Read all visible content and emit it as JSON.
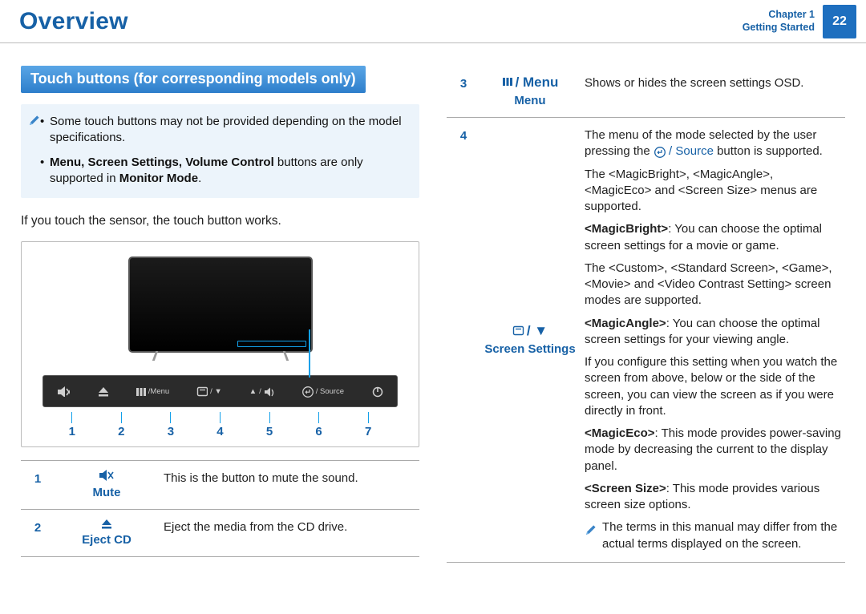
{
  "header": {
    "title": "Overview",
    "chapter_label": "Chapter 1",
    "section_label": "Getting Started",
    "page_no": "22"
  },
  "section_title": "Touch buttons (for corresponding models only)",
  "note_items": [
    {
      "prefix": "• ",
      "html": "Some touch buttons may not be provided depending on the model specifications."
    },
    {
      "prefix": "• ",
      "bold_lead": "Menu, Screen Settings, Volume Control",
      "mid": " buttons are only supported in ",
      "bold_tail": "Monitor Mode",
      "end": "."
    }
  ],
  "intro_line": "If you touch the sensor, the touch button works.",
  "btn_bar": {
    "cells": [
      {
        "name": "mute-btn"
      },
      {
        "name": "eject-btn"
      },
      {
        "name": "menu-btn",
        "text": "/Menu"
      },
      {
        "name": "screenset-btn",
        "text": "/ ▼"
      },
      {
        "name": "volume-btn",
        "text": "/"
      },
      {
        "name": "source-btn",
        "text": "/ Source"
      },
      {
        "name": "power-btn"
      }
    ]
  },
  "index_numbers": [
    "1",
    "2",
    "3",
    "4",
    "5",
    "6",
    "7"
  ],
  "table_left": [
    {
      "num": "1",
      "label": "Mute",
      "icon": "mute",
      "desc_plain": "This is the button to mute the sound."
    },
    {
      "num": "2",
      "label": "Eject CD",
      "icon": "eject",
      "desc_plain": "Eject the media from the CD drive."
    }
  ],
  "table_right": {
    "row3": {
      "num": "3",
      "icon_text": " / Menu",
      "label": "Menu",
      "desc": "Shows or hides the screen settings OSD."
    },
    "row4": {
      "num": "4",
      "icon_text": " / ▼",
      "label": "Screen Settings",
      "p1a": "The menu of the mode selected by the user pressing the ",
      "p1_btn": " / Source",
      "p1b": " button is supported.",
      "p2": "The <MagicBright>, <MagicAngle>, <MagicEco> and <Screen Size> menus are supported.",
      "p3_lead": "<MagicBright>",
      "p3_rest": ": You can choose the optimal screen settings for a movie or game.",
      "p4": "The <Custom>, <Standard Screen>, <Game>, <Movie> and <Video Contrast Setting> screen modes are supported.",
      "p5_lead": "<MagicAngle>",
      "p5_rest": ":  You can choose the optimal screen settings for your viewing angle.",
      "p6": "If you configure this setting when you watch the screen from above, below or the side of the screen, you can view the screen as if you were directly in front.",
      "p7_lead": "<MagicEco>",
      "p7_rest": ": This mode provides power-saving mode by decreasing the current to the display panel.",
      "p8_lead": "<Screen Size>",
      "p8_rest": ": This mode provides various screen size options.",
      "term_note": "The terms in this manual may differ from the actual terms displayed on the screen."
    }
  }
}
